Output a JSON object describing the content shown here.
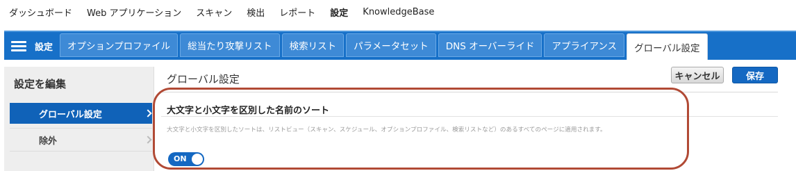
{
  "topnav": [
    "ダッシュボード",
    "Web アプリケーション",
    "スキャン",
    "検出",
    "レポート",
    "設定",
    "KnowledgeBase"
  ],
  "tabbar": {
    "title": "設定",
    "tabs": [
      "オプションプロファイル",
      "総当たり攻撃リスト",
      "検索リスト",
      "パラメータセット",
      "DNS オーバーライド",
      "アプライアンス",
      "グローバル設定"
    ]
  },
  "sidebar": {
    "title": "設定を編集",
    "items": [
      "グローバル設定",
      "除外"
    ]
  },
  "main": {
    "title": "グローバル設定",
    "cancel_label": "キャンセル",
    "save_label": "保存",
    "section_title": "大文字と小文字を区別した名前のソート",
    "section_desc": "大文字と小文字を区別したソートは、リストビュー（スキャン、スケジュール、オプションプロファイル、検索リストなど）のあるすべてのページに適用されます。",
    "toggle_label": "ON"
  },
  "colors": {
    "tabbar": "#1770c8",
    "primary_button": "#1468c2",
    "sidebar_active": "#1062b8",
    "highlight": "#b14a35"
  }
}
